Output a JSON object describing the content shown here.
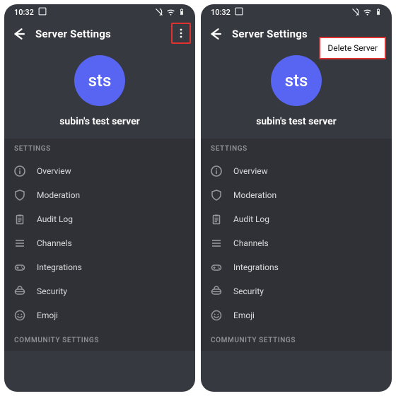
{
  "statusbar": {
    "time": "10:32",
    "indicators": [
      "screenshot",
      "mute",
      "wifi",
      "battery"
    ]
  },
  "header": {
    "title": "Server Settings",
    "more_label": "more",
    "delete_label": "Delete Server"
  },
  "server": {
    "avatar_initials": "sts",
    "name": "subin's test server"
  },
  "sections": [
    {
      "title": "SETTINGS",
      "items": [
        {
          "icon": "info",
          "label": "Overview"
        },
        {
          "icon": "shield",
          "label": "Moderation"
        },
        {
          "icon": "clipboard",
          "label": "Audit Log"
        },
        {
          "icon": "list",
          "label": "Channels"
        },
        {
          "icon": "gamepad",
          "label": "Integrations"
        },
        {
          "icon": "lock",
          "label": "Security"
        },
        {
          "icon": "emoji",
          "label": "Emoji"
        }
      ]
    },
    {
      "title": "COMMUNITY SETTINGS",
      "items": []
    }
  ],
  "colors": {
    "accent": "#5865F2",
    "highlight": "#e03131",
    "bg": "#36393f",
    "panel": "#2f3136"
  }
}
